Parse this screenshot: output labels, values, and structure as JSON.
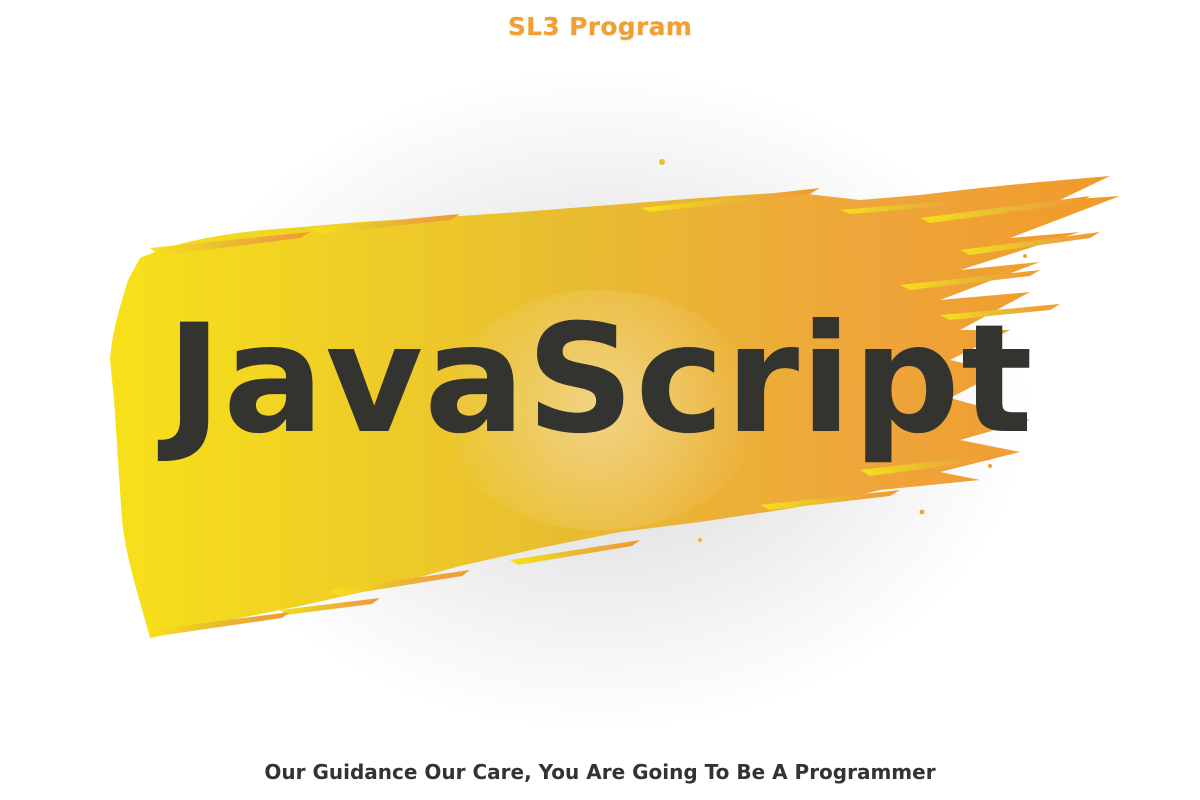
{
  "header": {
    "title": "SL3 Program"
  },
  "main": {
    "headline": "JavaScript",
    "brush_colors": [
      "#f7e11a",
      "#e8b52a",
      "#f0a030"
    ]
  },
  "footer": {
    "tagline": "Our Guidance Our Care, You Are Going To Be A Programmer"
  }
}
